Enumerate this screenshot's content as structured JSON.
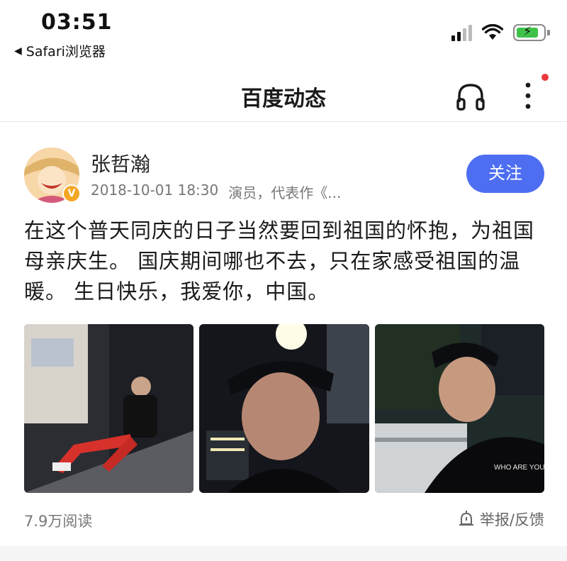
{
  "status_bar": {
    "time": "03:51",
    "back_label": "Safari浏览器",
    "back_icon": "back-triangle-icon",
    "icons": [
      "cellular-signal-icon",
      "wifi-icon",
      "battery-charging-icon"
    ],
    "battery_color": "#3ec24a"
  },
  "nav": {
    "title": "百度动态",
    "icons": [
      "headphone-icon",
      "more-vertical-icon"
    ],
    "notification_dot_color": "#e8383d"
  },
  "post": {
    "author": "张哲瀚",
    "verified_badge": "V",
    "date": "2018-10-01 18:30",
    "description": "演员，代表作《...",
    "follow_label": "关注",
    "follow_color": "#4e6ef2",
    "text": "在这个普天同庆的日子当然要回到祖国的怀抱，为祖国母亲庆生。 国庆期间哪也不去，只在家感受祖国的温暖。 生日快乐，我爱你，中国。",
    "photos": [
      {
        "name": "street-full-body-photo"
      },
      {
        "name": "night-selfie-photo"
      },
      {
        "name": "city-selfie-photo",
        "shirt_text": "WHO ARE YOU?"
      }
    ],
    "read_count": "7.9万阅读",
    "report_label": "举报/反馈",
    "report_icon": "report-bell-icon"
  }
}
